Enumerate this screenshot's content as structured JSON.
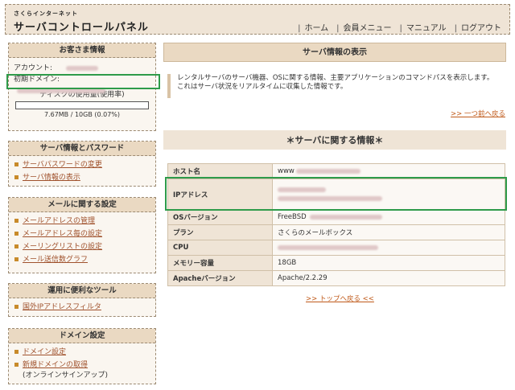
{
  "header": {
    "logo_small": "さくらインターネット",
    "logo_big": "サーバコントロールパネル",
    "nav": [
      "ホーム",
      "会員メニュー",
      "マニュアル",
      "ログアウト"
    ]
  },
  "sidebar": {
    "customer": {
      "title": "お客さま情報",
      "account_label": "アカウント:",
      "domain_label": "初期ドメイン:",
      "disk_label": "ディスクの使用量(使用率)",
      "disk_value": "7.67MB / 10GB (0.07%)",
      "disk_usage_fraction": 0.0007
    },
    "server": {
      "title": "サーバ情報とパスワード",
      "items": [
        "サーバパスワードの変更",
        "サーバ情報の表示"
      ]
    },
    "mail": {
      "title": "メールに関する設定",
      "items": [
        "メールアドレスの管理",
        "メールアドレス毎の設定",
        "メーリングリストの設定",
        "メール送信数グラフ"
      ]
    },
    "tools": {
      "title": "運用に便利なツール",
      "items": [
        "国外IPアドレスフィルタ"
      ]
    },
    "domain": {
      "title": "ドメイン設定",
      "items": [
        "ドメイン設定",
        "新規ドメインの取得"
      ],
      "sub": "(オンラインサインアップ)"
    }
  },
  "main": {
    "title": "サーバ情報の表示",
    "description_line1": "レンタルサーバのサーバ機器、OSに関する情報、主要アプリケーションのコマンドパスを表示します。",
    "description_line2": "これはサーバ状況をリアルタイムに収集した情報です。",
    "back_link": ">> 一つ前へ戻る",
    "section_title": "＊サーバに関する情報＊",
    "host_prefix": "www",
    "rows": [
      {
        "key": "ホスト名",
        "value": ""
      },
      {
        "key": "IPアドレス",
        "value": ""
      },
      {
        "key": "OSバージョン",
        "value": "FreeBSD"
      },
      {
        "key": "プラン",
        "value": "さくらのメールボックス"
      },
      {
        "key": "CPU",
        "value": ""
      },
      {
        "key": "メモリー容量",
        "value": "18GB"
      },
      {
        "key": "Apacheバージョン",
        "value": "Apache/2.2.29"
      }
    ],
    "top_link": ">> トップへ戻る <<"
  },
  "colors": {
    "accent": "#c05a1a",
    "highlight": "#2e9b4a",
    "panel": "#ead9c2"
  }
}
